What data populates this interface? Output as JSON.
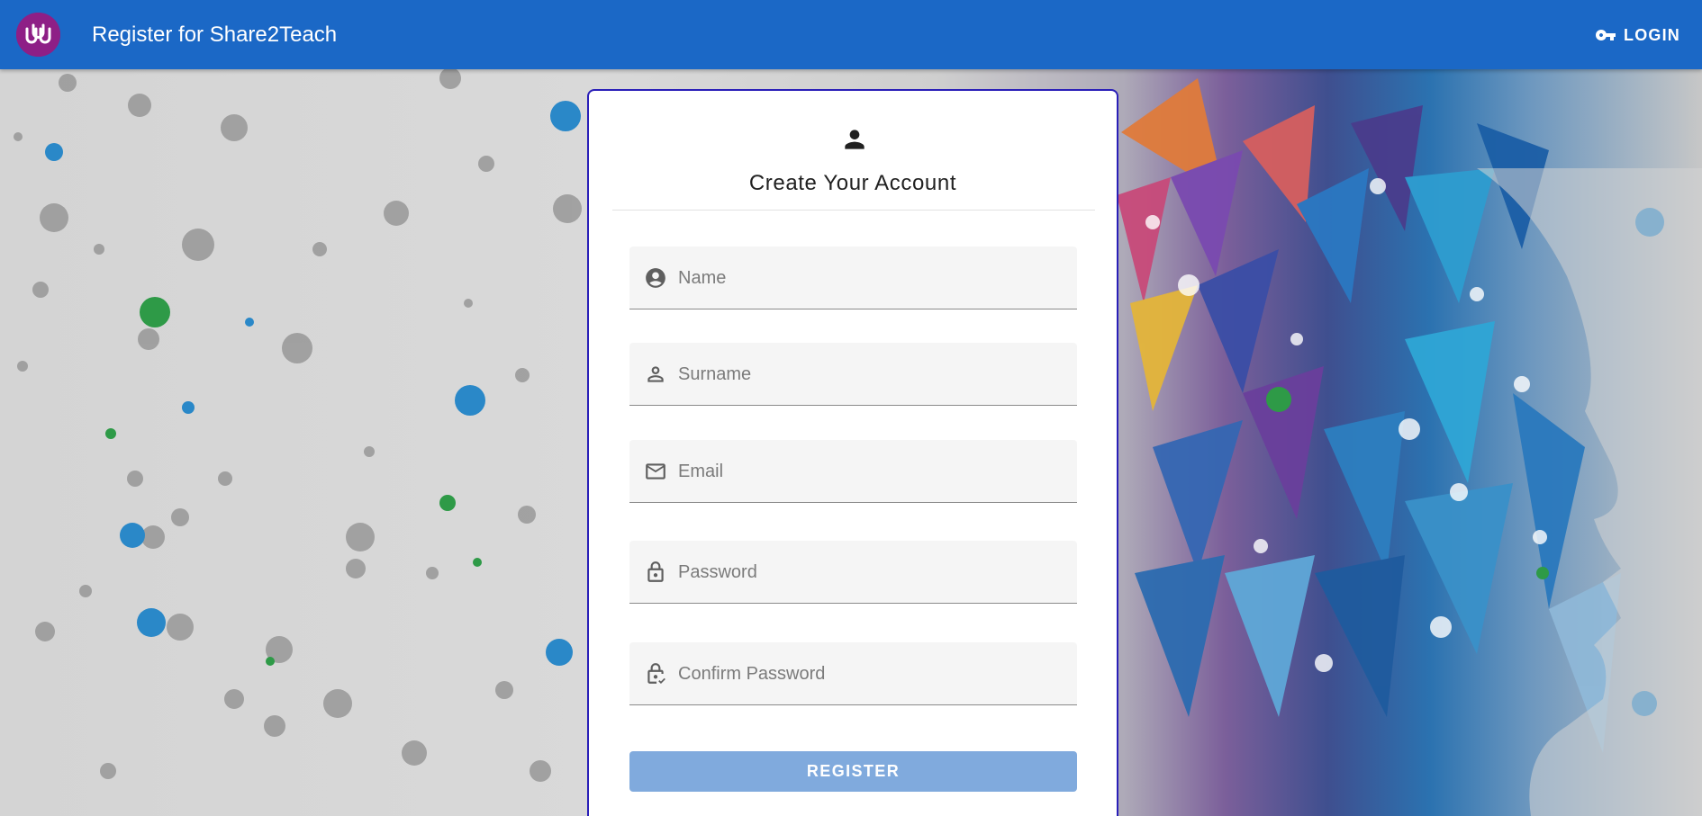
{
  "app": {
    "title": "Register for Share2Teach",
    "login_label": "LOGIN"
  },
  "card": {
    "title": "Create Your Account",
    "fields": [
      {
        "placeholder": "Name",
        "icon": "account-circle-icon"
      },
      {
        "placeholder": "Surname",
        "icon": "person-outline-icon"
      },
      {
        "placeholder": "Email",
        "icon": "mail-icon"
      },
      {
        "placeholder": "Password",
        "icon": "lock-icon"
      },
      {
        "placeholder": "Confirm Password",
        "icon": "lock-check-icon"
      }
    ],
    "register_label": "REGISTER"
  },
  "colors": {
    "appbar": "#1b68c6",
    "logo": "#8e1f86",
    "card_border": "#2a1fb8",
    "register_button": "#80aadd"
  }
}
